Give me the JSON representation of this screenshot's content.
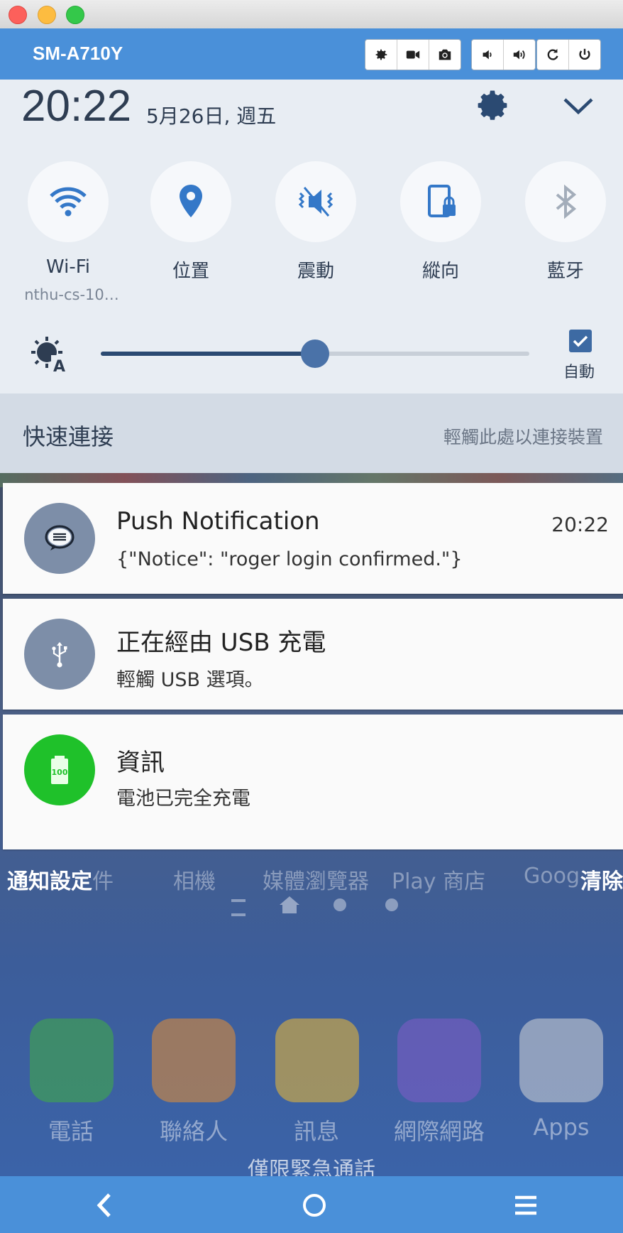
{
  "window": {
    "device_name": "SM-A710Y"
  },
  "toolbar": {
    "buttons": [
      {
        "name": "settings",
        "icon": "gear-icon"
      },
      {
        "name": "record",
        "icon": "video-camera-icon"
      },
      {
        "name": "screenshot",
        "icon": "camera-icon"
      },
      {
        "name": "volume-down",
        "icon": "volume-down-icon"
      },
      {
        "name": "volume-up",
        "icon": "volume-up-icon"
      },
      {
        "name": "rotate",
        "icon": "rotate-icon"
      },
      {
        "name": "power",
        "icon": "power-icon"
      }
    ]
  },
  "status": {
    "time": "20:22",
    "date": "5月26日, 週五"
  },
  "quick_tiles": [
    {
      "label": "Wi-Fi",
      "sub": "nthu-cs-10…",
      "icon": "wifi-icon",
      "active": true
    },
    {
      "label": "位置",
      "icon": "location-pin-icon",
      "active": true
    },
    {
      "label": "震動",
      "icon": "vibrate-icon",
      "active": true
    },
    {
      "label": "縱向",
      "icon": "portrait-lock-icon",
      "active": true
    },
    {
      "label": "藍牙",
      "icon": "bluetooth-icon",
      "active": false
    }
  ],
  "brightness": {
    "level": 0.5,
    "auto_label": "自動",
    "auto_checked": true
  },
  "quick_connect": {
    "title": "快速連接",
    "hint": "輕觸此處以連接裝置"
  },
  "notifications": [
    {
      "title": "Push Notification",
      "message": "{\"Notice\": \"roger login confirmed.\"}",
      "time": "20:22",
      "icon": "message-bubble-icon",
      "color": "#7d8ea8"
    },
    {
      "title": "正在經由 USB 充電",
      "message": "輕觸 USB 選項。",
      "icon": "usb-icon",
      "color": "#7d8ea8"
    },
    {
      "title": "資訊",
      "message": "電池已完全充電",
      "icon": "battery-full-icon",
      "color": "#1fc12a"
    }
  ],
  "notification_actions": {
    "settings": "通知設定",
    "clear": "清除"
  },
  "home_behind": {
    "top_row": [
      "件",
      "相機",
      "媒體瀏覽器",
      "Play 商店",
      "Goog"
    ],
    "dock": [
      "電話",
      "聯絡人",
      "訊息",
      "網際網路",
      "Apps"
    ],
    "emergency": "僅限緊急通話"
  },
  "colors": {
    "toolbar": "#4a90d9",
    "panel": "#e8edf3",
    "accent": "#2b4a72"
  }
}
